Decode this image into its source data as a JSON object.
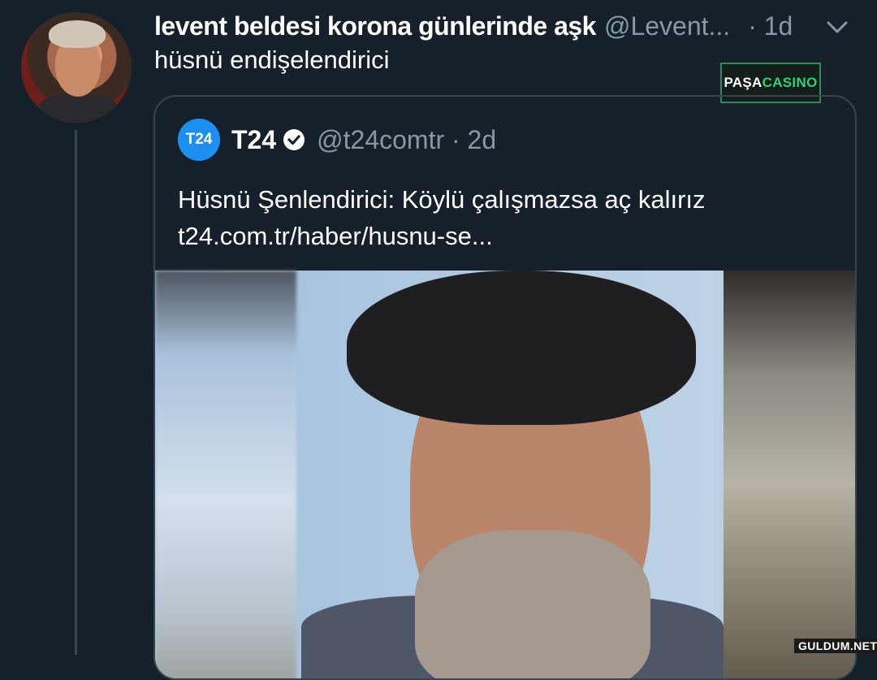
{
  "tweet": {
    "display_name": "levent beldesi korona günlerinde aşk",
    "handle": "@Levent...",
    "time": "· 1d",
    "text": "hüsnü endişelendirici"
  },
  "badge": {
    "prefix": "PAŞA",
    "suffix": "CASINO"
  },
  "quoted": {
    "logo_text": "T24",
    "name": "T24",
    "handle": "@t24comtr · 2d",
    "text": "Hüsnü Şenlendirici: Köylü çalışmazsa aç kalırız",
    "link": "t24.com.tr/haber/husnu-se..."
  },
  "watermark": "GULDUM.NET",
  "colors": {
    "background": "#15202b",
    "secondary_text": "#8899a6",
    "border": "#38444d",
    "logo_blue": "#1d8ff0",
    "badge_green": "#2fd07d"
  },
  "icons": {
    "chevron": "chevron-down-icon",
    "verified": "verified-badge-icon"
  }
}
